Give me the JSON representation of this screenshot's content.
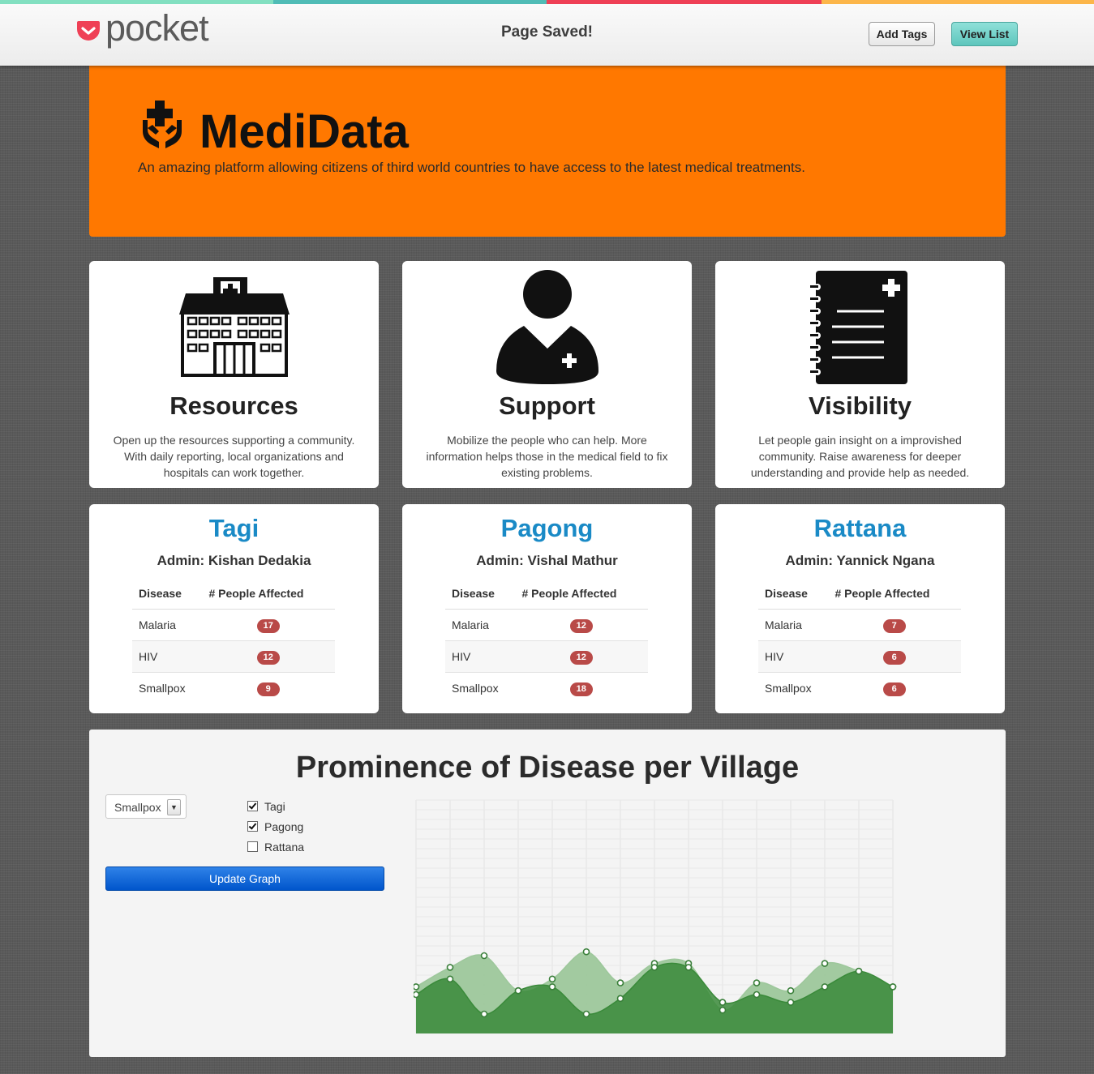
{
  "pocket": {
    "wordmark": "pocket",
    "status": "Page Saved!",
    "add_tags": "Add Tags",
    "view_list": "View List",
    "stripe_colors": [
      "#83e0c1",
      "#50bcb6",
      "#ef4056",
      "#fcb64a"
    ]
  },
  "hero": {
    "title": "MediData",
    "subtitle": "An amazing platform allowing citizens of third world countries to have access to the latest medical treatments.",
    "icon": "hands-medical-cross-icon",
    "color": "#ff7800"
  },
  "features": [
    {
      "title": "Resources",
      "icon": "hospital-icon",
      "description": "Open up the resources supporting a community. With daily reporting, local organizations and hospitals can work together."
    },
    {
      "title": "Support",
      "icon": "doctor-icon",
      "description": "Mobilize the people who can help. More information helps those in the medical field to fix existing problems."
    },
    {
      "title": "Visibility",
      "icon": "medical-notebook-icon",
      "description": "Let people gain insight on a improvished community. Raise awareness for deeper understanding and provide help as needed."
    }
  ],
  "villages": [
    {
      "name": "Tagi",
      "admin": "Admin: Kishan Dedakia",
      "rows": [
        {
          "disease": "Malaria",
          "count": "17"
        },
        {
          "disease": "HIV",
          "count": "12"
        },
        {
          "disease": "Smallpox",
          "count": "9"
        }
      ]
    },
    {
      "name": "Pagong",
      "admin": "Admin: Vishal Mathur",
      "rows": [
        {
          "disease": "Malaria",
          "count": "12"
        },
        {
          "disease": "HIV",
          "count": "12"
        },
        {
          "disease": "Smallpox",
          "count": "18"
        }
      ]
    },
    {
      "name": "Rattana",
      "admin": "Admin: Yannick Ngana",
      "rows": [
        {
          "disease": "Malaria",
          "count": "7"
        },
        {
          "disease": "HIV",
          "count": "6"
        },
        {
          "disease": "Smallpox",
          "count": "6"
        }
      ]
    }
  ],
  "table_headers": {
    "disease": "Disease",
    "affected": "# People Affected"
  },
  "graph": {
    "title": "Prominence of Disease per Village",
    "disease_select": "Smallpox",
    "checkboxes": [
      {
        "label": "Tagi",
        "checked": true
      },
      {
        "label": "Pagong",
        "checked": true
      },
      {
        "label": "Rattana",
        "checked": false
      }
    ],
    "update_button": "Update Graph",
    "accent": "#0055cc"
  },
  "chart_data": {
    "type": "area",
    "title": "",
    "xlabel": "",
    "ylabel": "",
    "grid": true,
    "x": [
      0,
      1,
      2,
      3,
      4,
      5,
      6,
      7,
      8,
      9,
      10,
      11,
      12,
      13,
      14
    ],
    "ylim": [
      0,
      60
    ],
    "series": [
      {
        "color": "#9dc79b",
        "values": [
          12,
          17,
          20,
          11,
          14,
          21,
          13,
          18,
          18,
          6,
          13,
          11,
          18,
          16,
          12
        ]
      },
      {
        "color": "#3a8a3a",
        "values": [
          10,
          14,
          5,
          11,
          12,
          5,
          9,
          17,
          17,
          8,
          10,
          8,
          12,
          16,
          12
        ]
      }
    ]
  }
}
